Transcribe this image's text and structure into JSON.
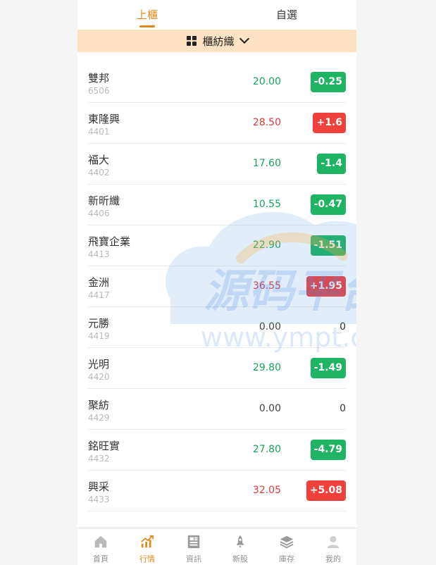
{
  "top_tabs": [
    "上櫃",
    "自選"
  ],
  "industry_filter": {
    "label": "櫃紡織"
  },
  "colors": {
    "accent": "#e08a1e",
    "up": "#f0403c",
    "down": "#1fb464",
    "filter_bg": "#fde3c4"
  },
  "stocks": [
    {
      "name": "雙邦",
      "code": "6506",
      "price": "20.00",
      "change": "-0.25",
      "direction": "down"
    },
    {
      "name": "東隆興",
      "code": "4401",
      "price": "28.50",
      "change": "+1.6",
      "direction": "up"
    },
    {
      "name": "福大",
      "code": "4402",
      "price": "17.60",
      "change": "-1.4",
      "direction": "down"
    },
    {
      "name": "新昕纖",
      "code": "4406",
      "price": "10.55",
      "change": "-0.47",
      "direction": "down"
    },
    {
      "name": "飛寶企業",
      "code": "4413",
      "price": "22.90",
      "change": "-1.51",
      "direction": "down"
    },
    {
      "name": "金洲",
      "code": "4417",
      "price": "36.55",
      "change": "+1.95",
      "direction": "up"
    },
    {
      "name": "元勝",
      "code": "4419",
      "price": "0.00",
      "change": "0",
      "direction": "flat"
    },
    {
      "name": "光明",
      "code": "4420",
      "price": "29.80",
      "change": "-1.49",
      "direction": "down"
    },
    {
      "name": "聚紡",
      "code": "4429",
      "price": "0.00",
      "change": "0",
      "direction": "flat"
    },
    {
      "name": "銘旺實",
      "code": "4432",
      "price": "27.80",
      "change": "-4.79",
      "direction": "down"
    },
    {
      "name": "興采",
      "code": "4433",
      "price": "32.05",
      "change": "+5.08",
      "direction": "up"
    }
  ],
  "watermark": {
    "text": "源码平台",
    "url": "www.ympt.cc"
  },
  "bottom_nav": [
    {
      "label": "首頁",
      "icon": "home-icon",
      "active": false
    },
    {
      "label": "行情",
      "icon": "chart-icon",
      "active": true
    },
    {
      "label": "資訊",
      "icon": "news-icon",
      "active": false
    },
    {
      "label": "新股",
      "icon": "rocket-icon",
      "active": false
    },
    {
      "label": "庫存",
      "icon": "layers-icon",
      "active": false
    },
    {
      "label": "我的",
      "icon": "user-icon",
      "active": false
    }
  ]
}
